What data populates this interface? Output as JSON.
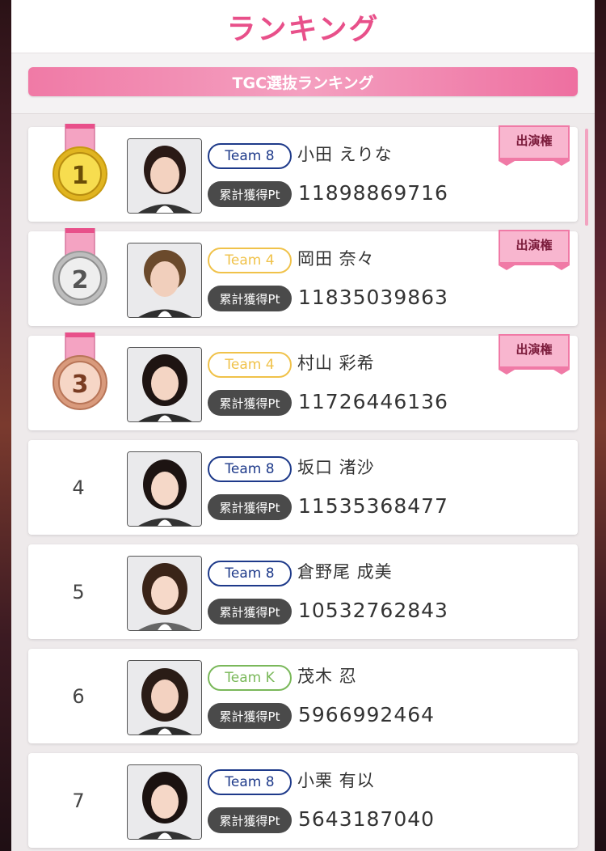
{
  "header": {
    "title": "ランキング"
  },
  "subbar": {
    "label": "TGC選抜ランキング"
  },
  "colors": {
    "accent_pink": "#e8508a",
    "team8": "#1e3a8a",
    "team4": "#f0c24a",
    "teamK": "#7ab85a"
  },
  "pt_label": "累計獲得Pt",
  "entries": [
    {
      "rank": "1",
      "team": "Team 8",
      "team_color": "#1e3a8a",
      "name": "小田 えりな",
      "points": "11898869716",
      "badge": "出演権",
      "medal": "gold"
    },
    {
      "rank": "2",
      "team": "Team 4",
      "team_color": "#f0c24a",
      "name": "岡田 奈々",
      "points": "11835039863",
      "badge": "出演権",
      "medal": "silver"
    },
    {
      "rank": "3",
      "team": "Team 4",
      "team_color": "#f0c24a",
      "name": "村山 彩希",
      "points": "11726446136",
      "badge": "出演権",
      "medal": "bronze"
    },
    {
      "rank": "4",
      "team": "Team 8",
      "team_color": "#1e3a8a",
      "name": "坂口 渚沙",
      "points": "11535368477",
      "badge": "",
      "medal": ""
    },
    {
      "rank": "5",
      "team": "Team 8",
      "team_color": "#1e3a8a",
      "name": "倉野尾 成美",
      "points": "10532762843",
      "badge": "",
      "medal": ""
    },
    {
      "rank": "6",
      "team": "Team K",
      "team_color": "#7ab85a",
      "name": "茂木 忍",
      "points": "5966992464",
      "badge": "",
      "medal": ""
    },
    {
      "rank": "7",
      "team": "Team 8",
      "team_color": "#1e3a8a",
      "name": "小栗 有以",
      "points": "5643187040",
      "badge": "",
      "medal": ""
    }
  ]
}
